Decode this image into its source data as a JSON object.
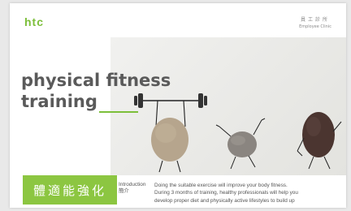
{
  "header": {
    "logo": "htc",
    "clinic_cn": "員工診所",
    "clinic_en": "Employee Clinic"
  },
  "hero": {
    "title_line1": "physical fitness",
    "title_line2": "training"
  },
  "banner": {
    "label_cn": "體適能強化"
  },
  "introduction": {
    "label_en": "Introduction",
    "label_cn": "簡介",
    "line1": "Doing the suitable exercise will improve your body fitness.",
    "line2": "During 3 months of training, healthy professionals will help you",
    "line3": "develop proper diet and physically active lifestyles to build up"
  },
  "colors": {
    "accent_green": "#8cc641",
    "logo_green": "#7cbf3a",
    "title_gray": "#5a5a5a"
  }
}
